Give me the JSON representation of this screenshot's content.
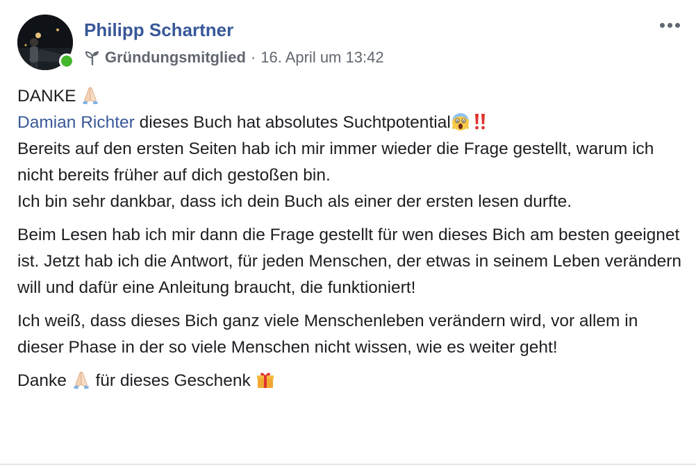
{
  "post": {
    "author": "Philipp Schartner",
    "badge_icon": "sprout-icon",
    "badge": "Gründungsmitglied",
    "separator": "·",
    "timestamp": "16. April um 13:42",
    "more_icon": "more-options-icon",
    "body": {
      "line1": "DANKE",
      "line2_mention": "Damian Richter",
      "line2_text": " dieses Buch hat absolutes Suchtpotential",
      "line3": "Bereits auf den ersten Seiten hab ich mir immer wieder die Frage gestellt, warum ich nicht bereits früher auf dich gestoßen bin.",
      "line4": "Ich bin sehr dankbar, dass ich dein Buch als einer der ersten lesen durfte.",
      "para2": "Beim Lesen hab ich mir dann die Frage gestellt für wen dieses Bich am besten geeignet ist. Jetzt hab ich die Antwort, für jeden Menschen, der etwas in seinem Leben verändern will und dafür eine Anleitung braucht, die funktioniert!",
      "para3": "Ich weiß, dass dieses Bich ganz viele Menschenleben verändern wird, vor allem in dieser Phase in der so viele Menschen nicht wissen, wie es weiter geht!",
      "para4_a": "Danke",
      "para4_b": " für dieses Geschenk"
    },
    "emojis": [
      "folded-hands",
      "screaming-face",
      "double-exclamation",
      "wrapped-gift"
    ],
    "colors": {
      "link": "#385898",
      "meta": "#606770",
      "text": "#1c1e21",
      "online": "#42b72a"
    }
  }
}
